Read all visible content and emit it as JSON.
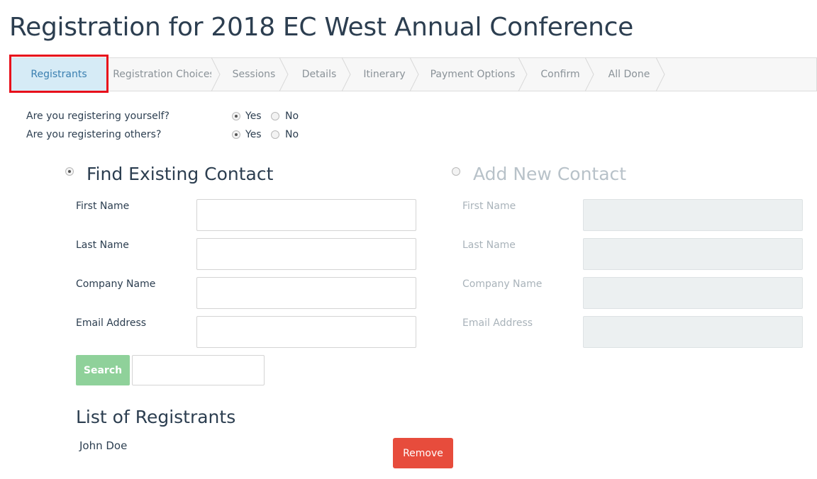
{
  "page": {
    "title": "Registration for 2018 EC West Annual Conference"
  },
  "steps": [
    {
      "label": "Registrants",
      "active": true
    },
    {
      "label": "Registration Choices"
    },
    {
      "label": "Sessions"
    },
    {
      "label": "Details"
    },
    {
      "label": "Itinerary"
    },
    {
      "label": "Payment Options"
    },
    {
      "label": "Confirm"
    },
    {
      "label": "All Done"
    }
  ],
  "questions": [
    {
      "text": "Are you registering yourself?",
      "yes_label": "Yes",
      "no_label": "No",
      "selected": "Yes"
    },
    {
      "text": "Are you registering others?",
      "yes_label": "Yes",
      "no_label": "No",
      "selected": "Yes"
    }
  ],
  "find_contact": {
    "title": "Find Existing Contact",
    "selected": true,
    "fields": [
      {
        "label": "First Name",
        "value": ""
      },
      {
        "label": "Last Name",
        "value": ""
      },
      {
        "label": "Company Name",
        "value": ""
      },
      {
        "label": "Email Address",
        "value": ""
      }
    ],
    "search_label": "Search"
  },
  "add_contact": {
    "title": "Add New Contact",
    "selected": false,
    "fields": [
      {
        "label": "First Name",
        "value": ""
      },
      {
        "label": "Last Name",
        "value": ""
      },
      {
        "label": "Company Name",
        "value": ""
      },
      {
        "label": "Email Address",
        "value": ""
      }
    ]
  },
  "registrants": {
    "title": "List of Registrants",
    "items": [
      {
        "name": "John Doe",
        "remove_label": "Remove"
      }
    ]
  },
  "colors": {
    "active_step_bg": "#d6ebf6",
    "highlight_outline": "#e8101b",
    "search_button": "#8fd19a",
    "remove_button": "#e74c3c"
  }
}
